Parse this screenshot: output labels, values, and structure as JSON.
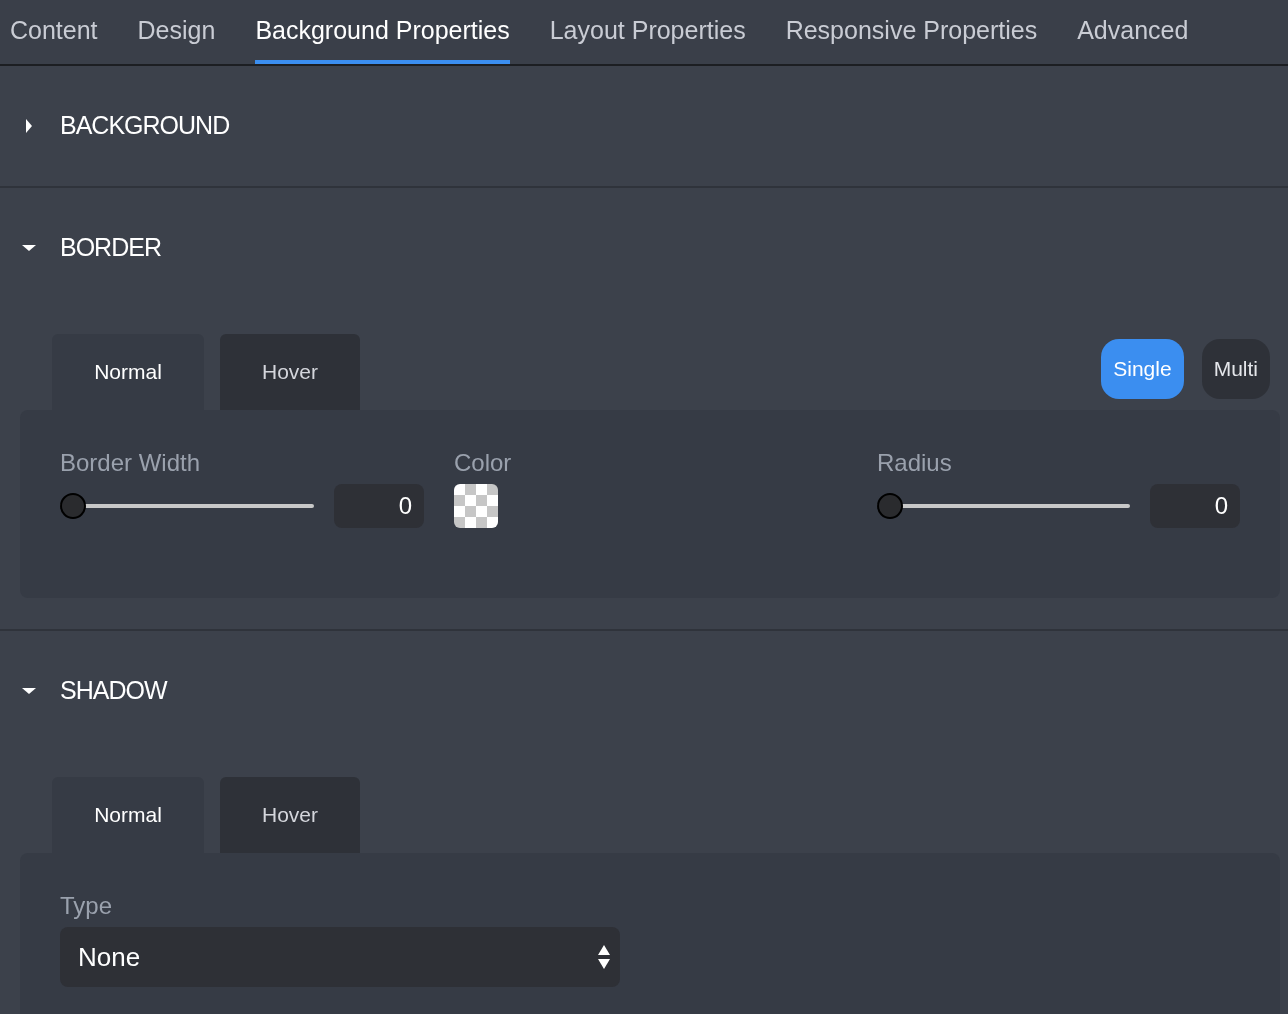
{
  "tabs": [
    {
      "label": "Content",
      "selected": false
    },
    {
      "label": "Design",
      "selected": false
    },
    {
      "label": "Background Properties",
      "selected": true
    },
    {
      "label": "Layout Properties",
      "selected": false
    },
    {
      "label": "Responsive Properties",
      "selected": false
    },
    {
      "label": "Advanced",
      "selected": false
    }
  ],
  "sections": [
    {
      "title": "BACKGROUND",
      "expanded": false
    },
    {
      "title": "BORDER",
      "expanded": true,
      "state_tabs": [
        {
          "label": "Normal",
          "selected": true
        },
        {
          "label": "Hover",
          "selected": false
        }
      ],
      "mode_buttons": [
        {
          "label": "Single",
          "selected": true
        },
        {
          "label": "Multi",
          "selected": false
        }
      ],
      "fields": [
        {
          "kind": "slider",
          "label": "Border Width",
          "level": 0,
          "value": "0"
        },
        {
          "kind": "color",
          "label": "Color"
        },
        {
          "kind": "slider",
          "label": "Radius",
          "level": 0,
          "value": "0"
        }
      ]
    },
    {
      "title": "SHADOW",
      "expanded": true,
      "state_tabs": [
        {
          "label": "Normal",
          "selected": true
        },
        {
          "label": "Hover",
          "selected": false
        }
      ],
      "fields": [
        {
          "kind": "select",
          "label": "Type",
          "value": "None"
        }
      ]
    }
  ]
}
